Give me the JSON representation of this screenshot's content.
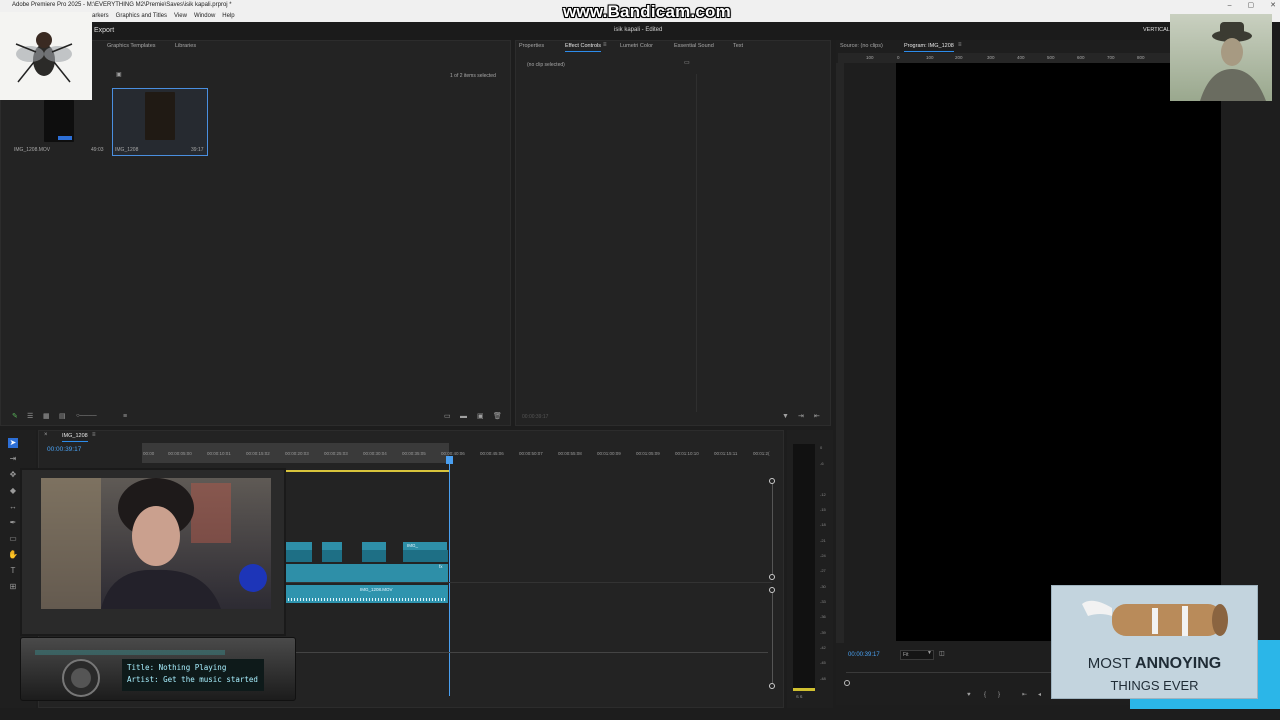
{
  "window": {
    "title": "Adobe Premiere Pro 2025 - M:\\EVERYTHING M2\\Premie\\Saves\\isik kapali.prproj *",
    "controls": [
      "–",
      "▢",
      "✕"
    ]
  },
  "menu": [
    "arkers",
    "Graphics and Titles",
    "View",
    "Window",
    "Help"
  ],
  "watermark": "www.Bandicam.com",
  "header": {
    "export": "Export",
    "project_title": "isik kapali - Edited",
    "workspace": "VERTICAL"
  },
  "project_panel": {
    "tabs": [
      "Graphics Templates",
      "Libraries"
    ],
    "selection_info": "1 of 2 items selected",
    "items": [
      {
        "name": "IMG_1208.MOV",
        "duration": "49:03"
      },
      {
        "name": "IMG_1208",
        "duration": "39:17"
      }
    ]
  },
  "effect_panel": {
    "tabs": [
      "Properties",
      "Effect Controls",
      "Lumetri Color",
      "Essential Sound",
      "Text"
    ],
    "active_tab": "Effect Controls",
    "empty_text": "(no clip selected)",
    "timecode": "00:00:39:17"
  },
  "program_panel": {
    "source_tab": "Source: (no clips)",
    "program_tab": "Program: IMG_1208",
    "ruler": [
      "100",
      "0",
      "100",
      "200",
      "300",
      "400",
      "500",
      "600",
      "700",
      "800"
    ],
    "timecode": "00:00:39:17",
    "fit": "Fit"
  },
  "timeline": {
    "sequence_name": "IMG_1208",
    "timecode": "00:00:39:17",
    "ruler": [
      "00:00",
      "00:00:05:00",
      "00:00:10:01",
      "00:00:15:02",
      "00:00:20:03",
      "00:00:25:03",
      "00:00:30:04",
      "00:00:35:05",
      "00:00:40:06",
      "00:00:45:06",
      "00:00:50:07",
      "00:00:55:08",
      "00:01:00:09",
      "00:01:05:09",
      "00:01:10:10",
      "00:01:15:11",
      "00:01:2("
    ],
    "clip_labels": {
      "video_small": "IMG_",
      "audio": "IMG_1208.MOV",
      "fx": "fx"
    }
  },
  "audio_meter": {
    "scale": [
      "0",
      "-6",
      "-12",
      "-15",
      "-18",
      "-21",
      "-24",
      "-27",
      "-30",
      "-33",
      "-36",
      "-39",
      "-42",
      "-45",
      "-48"
    ],
    "channels": "S S"
  },
  "overlays": {
    "radio_title": "Title: Nothing Playing",
    "radio_artist": "Artist: Get the music started",
    "meme_line1_a": "MOST ",
    "meme_line1_b": "ANNOYING",
    "meme_line2": "THINGS EVER"
  },
  "colors": {
    "accent": "#2d8ceb",
    "clip": "#2e8fa8",
    "playhead": "#4a9ff0"
  }
}
